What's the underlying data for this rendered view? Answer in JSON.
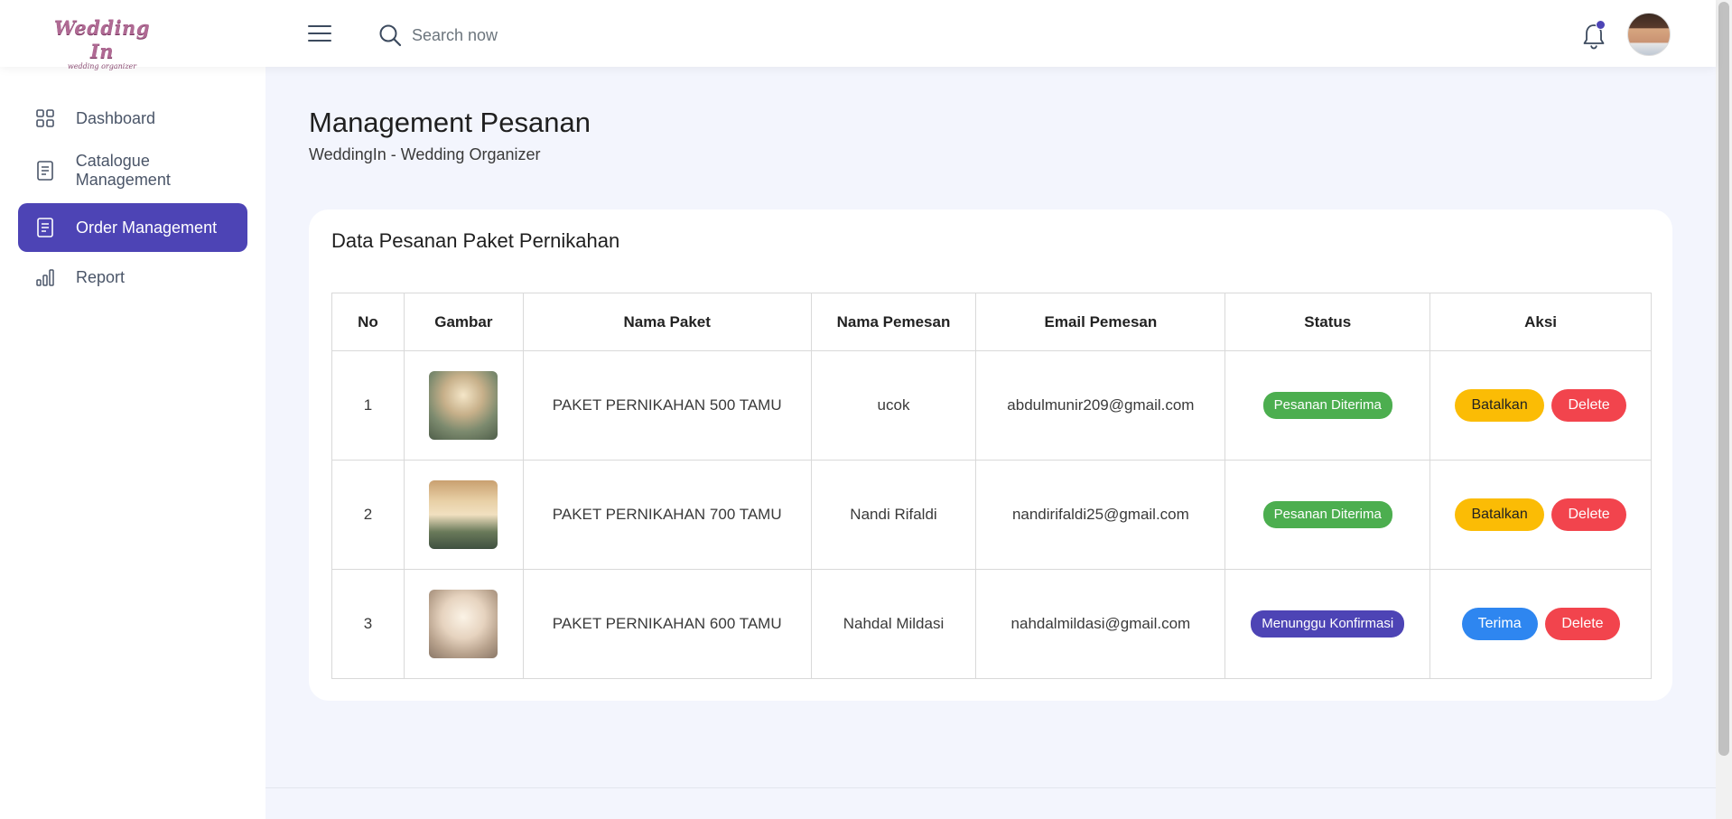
{
  "brand": {
    "logo_text": "Wedding In",
    "logo_subtext": "wedding organizer"
  },
  "search": {
    "placeholder": "Search now"
  },
  "header": {
    "notification_icon": "bell-icon",
    "menu_icon": "hamburger-icon"
  },
  "sidebar": {
    "items": [
      {
        "label": "Dashboard",
        "icon": "grid-icon",
        "active": false
      },
      {
        "label": "Catalogue Management",
        "icon": "document-icon",
        "active": false
      },
      {
        "label": "Order Management",
        "icon": "document-icon",
        "active": true
      },
      {
        "label": "Report",
        "icon": "bar-chart-icon",
        "active": false
      }
    ]
  },
  "page": {
    "title": "Management Pesanan",
    "subtitle": "WeddingIn - Wedding Organizer"
  },
  "card": {
    "title": "Data Pesanan Paket Pernikahan",
    "columns": [
      "No",
      "Gambar",
      "Nama Paket",
      "Nama Pemesan",
      "Email Pemesan",
      "Status",
      "Aksi"
    ],
    "rows": [
      {
        "no": "1",
        "package": "PAKET PERNIKAHAN 500 TAMU",
        "customer": "ucok",
        "email": "abdulmunir209@gmail.com",
        "status": "Pesanan Diterima",
        "primary_action": "Batalkan",
        "secondary_action": "Delete"
      },
      {
        "no": "2",
        "package": "PAKET PERNIKAHAN 700 TAMU",
        "customer": "Nandi Rifaldi",
        "email": "nandirifaldi25@gmail.com",
        "status": "Pesanan Diterima",
        "primary_action": "Batalkan",
        "secondary_action": "Delete"
      },
      {
        "no": "3",
        "package": "PAKET PERNIKAHAN 600 TAMU",
        "customer": "Nahdal Mildasi",
        "email": "nahdalmildasi@gmail.com",
        "status": "Menunggu Konfirmasi",
        "primary_action": "Terima",
        "secondary_action": "Delete"
      }
    ]
  },
  "colors": {
    "accent": "#4d44b5",
    "status_accepted": "#4cae4f",
    "status_pending": "#4d44b5",
    "cancel_button": "#fbbc05",
    "delete_button": "#f2444d",
    "accept_button": "#2e86f0",
    "background": "#f3f5fd"
  }
}
